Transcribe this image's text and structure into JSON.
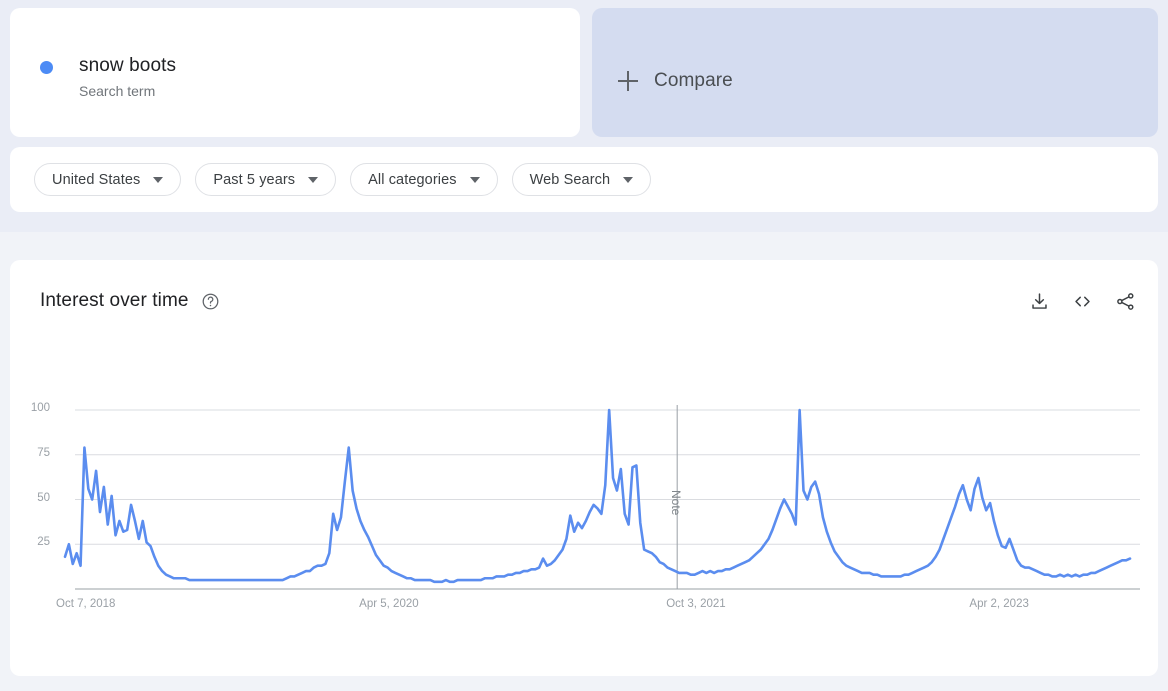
{
  "search_term": {
    "title": "snow boots",
    "subtitle": "Search term",
    "dot_color": "#4c8bf5"
  },
  "compare": {
    "label": "Compare",
    "icon": "plus-icon"
  },
  "filters": [
    {
      "label": "United States",
      "icon": "chevron-down-icon"
    },
    {
      "label": "Past 5 years",
      "icon": "chevron-down-icon"
    },
    {
      "label": "All categories",
      "icon": "chevron-down-icon"
    },
    {
      "label": "Web Search",
      "icon": "chevron-down-icon"
    }
  ],
  "chart_panel": {
    "title": "Interest over time",
    "help_icon": "help-circle-icon",
    "actions": [
      {
        "name": "download-icon",
        "label": "Download"
      },
      {
        "name": "embed-code-icon",
        "label": "Embed"
      },
      {
        "name": "share-icon",
        "label": "Share"
      }
    ]
  },
  "chart_data": {
    "type": "line",
    "title": "Interest over time",
    "xlabel": "",
    "ylabel": "",
    "ylim": [
      0,
      100
    ],
    "yticks": [
      25,
      50,
      75,
      100
    ],
    "ytick_labels": [
      "25",
      "50",
      "75",
      "100"
    ],
    "xtick_labels": [
      "Oct 7, 2018",
      "Apr 5, 2020",
      "Oct 3, 2021",
      "Apr 2, 2023"
    ],
    "xtick_positions": [
      0,
      78,
      157,
      235
    ],
    "grid": true,
    "legend": [
      "snow boots"
    ],
    "line_color": "#5b8def",
    "annotations": [
      {
        "type": "vertical-line",
        "label": "Note",
        "x_index": 157.5
      }
    ],
    "series": [
      {
        "name": "snow boots",
        "values": [
          18,
          25,
          14,
          20,
          13,
          79,
          56,
          50,
          66,
          43,
          57,
          36,
          52,
          30,
          38,
          32,
          33,
          47,
          38,
          28,
          38,
          26,
          24,
          18,
          13,
          10,
          8,
          7,
          6,
          6,
          6,
          6,
          5,
          5,
          5,
          5,
          5,
          5,
          5,
          5,
          5,
          5,
          5,
          5,
          5,
          5,
          5,
          5,
          5,
          5,
          5,
          5,
          5,
          5,
          5,
          5,
          5,
          6,
          7,
          7,
          8,
          9,
          10,
          10,
          12,
          13,
          13,
          14,
          20,
          42,
          33,
          40,
          60,
          79,
          55,
          45,
          38,
          33,
          29,
          24,
          19,
          16,
          13,
          12,
          10,
          9,
          8,
          7,
          6,
          6,
          5,
          5,
          5,
          5,
          5,
          4,
          4,
          4,
          5,
          4,
          4,
          5,
          5,
          5,
          5,
          5,
          5,
          5,
          6,
          6,
          6,
          7,
          7,
          7,
          8,
          8,
          9,
          9,
          10,
          10,
          11,
          11,
          12,
          17,
          13,
          14,
          16,
          19,
          22,
          28,
          41,
          32,
          37,
          34,
          38,
          43,
          47,
          45,
          42,
          58,
          100,
          62,
          55,
          67,
          42,
          36,
          68,
          69,
          37,
          22,
          21,
          20,
          18,
          15,
          14,
          12,
          11,
          10,
          9,
          9,
          9,
          8,
          8,
          9,
          10,
          9,
          10,
          9,
          10,
          10,
          11,
          11,
          12,
          13,
          14,
          15,
          16,
          18,
          20,
          22,
          25,
          28,
          33,
          39,
          45,
          50,
          46,
          42,
          36,
          100,
          55,
          50,
          57,
          60,
          53,
          40,
          32,
          26,
          21,
          18,
          15,
          13,
          12,
          11,
          10,
          9,
          9,
          9,
          8,
          8,
          7,
          7,
          7,
          7,
          7,
          7,
          8,
          8,
          9,
          10,
          11,
          12,
          13,
          15,
          18,
          22,
          28,
          34,
          40,
          46,
          53,
          58,
          50,
          44,
          56,
          62,
          51,
          44,
          48,
          38,
          30,
          24,
          23,
          28,
          22,
          16,
          13,
          12,
          12,
          11,
          10,
          9,
          8,
          8,
          7,
          7,
          8,
          7,
          8,
          7,
          8,
          7,
          8,
          8,
          9,
          9,
          10,
          11,
          12,
          13,
          14,
          15,
          16,
          16,
          17
        ]
      }
    ]
  }
}
